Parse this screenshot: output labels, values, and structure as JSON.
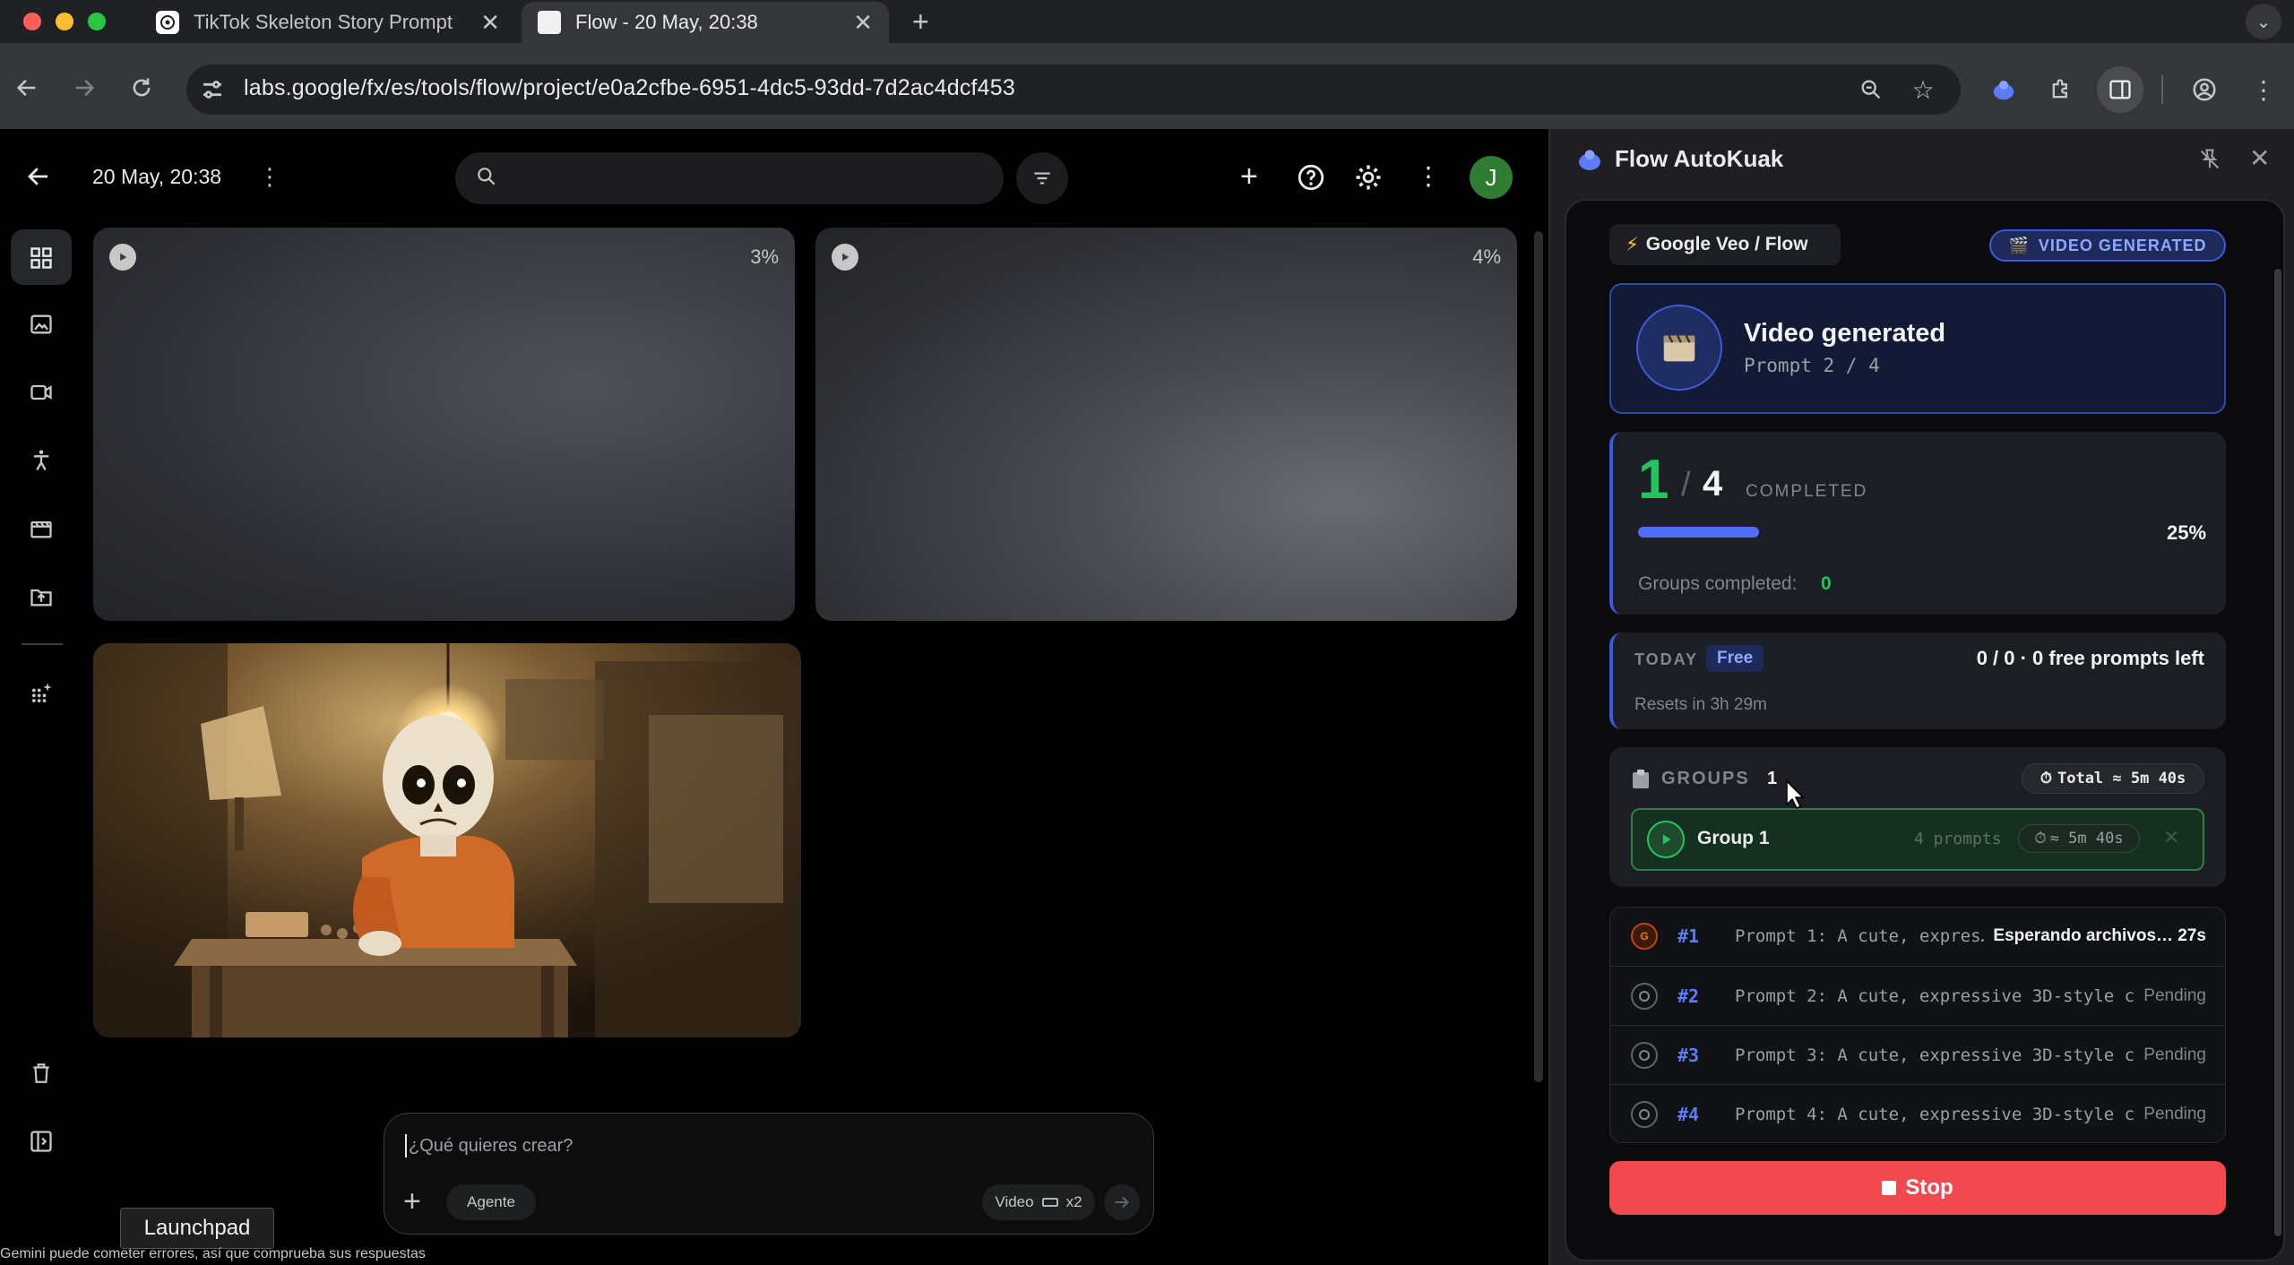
{
  "browser": {
    "tabs": [
      {
        "title": "TikTok Skeleton Story Prompt",
        "active": false
      },
      {
        "title": "Flow - 20 May, 20:38",
        "active": true
      }
    ],
    "url": "labs.google/fx/es/tools/flow/project/e0a2cfbe-6951-4dc5-93dd-7d2ac4dcf453"
  },
  "app": {
    "date": "20 May, 20:38",
    "avatar_letter": "J",
    "cards": [
      {
        "percent": "3%"
      },
      {
        "percent": "4%"
      }
    ],
    "prompt": {
      "placeholder": "¿Qué quieres crear?",
      "agent_label": "Agente",
      "mode_label": "Video",
      "count_label": "x2"
    },
    "launchpad": "Launchpad",
    "disclaimer": "Gemini puede cometer errores, así que comprueba sus respuestas"
  },
  "panel": {
    "title": "Flow AutoKuak",
    "platform": "Google Veo / Flow",
    "badge": "VIDEO GENERATED",
    "status_title": "Video generated",
    "status_sub": "Prompt 2 / 4",
    "progress": {
      "done": "1",
      "sep": "/",
      "total": "4",
      "label": "COMPLETED",
      "percent_label": "25%",
      "fraction": 0.25,
      "groups_label": "Groups completed:",
      "groups_value": "0"
    },
    "today": {
      "label": "TODAY",
      "plan": "Free",
      "left": "0 / 0 · 0 free prompts left",
      "resets": "Resets in 3h 29m"
    },
    "groups": {
      "label": "GROUPS",
      "count": "1",
      "total": "Total ≈ 5m 40s",
      "items": [
        {
          "name": "Group 1",
          "prompts": "4 prompts",
          "time": "≈ 5m 40s"
        }
      ]
    },
    "prompts": [
      {
        "num": "#1",
        "text": "Prompt 1: A cute, expres…",
        "status": "Esperando archivos… 27s",
        "state": "active"
      },
      {
        "num": "#2",
        "text": "Prompt 2: A cute, expressive 3D-style c…",
        "status": "Pending",
        "state": "pending"
      },
      {
        "num": "#3",
        "text": "Prompt 3: A cute, expressive 3D-style c…",
        "status": "Pending",
        "state": "pending"
      },
      {
        "num": "#4",
        "text": "Prompt 4: A cute, expressive 3D-style c…",
        "status": "Pending",
        "state": "pending"
      }
    ],
    "stop_label": "Stop"
  },
  "colors": {
    "accent_blue": "#4f6ef7",
    "success_green": "#22c55e",
    "stop_red": "#f04a4f"
  }
}
